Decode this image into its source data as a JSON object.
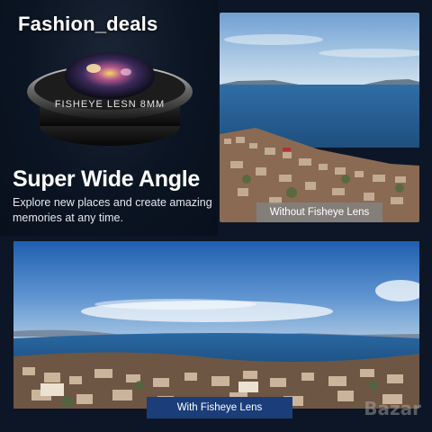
{
  "watermark": "Fashion_deals",
  "lens_engraving": "FISHEYE LESN 8MM",
  "headline": "Super Wide Angle",
  "description": "Explore new places and create amazing memories at any time.",
  "label_without": "Without Fisheye Lens",
  "label_with": "With Fisheye Lens",
  "corner_mark": "Bazar",
  "colors": {
    "background": "#0c1626",
    "label_with_bg": "#1b3d7a",
    "label_without_bg": "#828282"
  }
}
